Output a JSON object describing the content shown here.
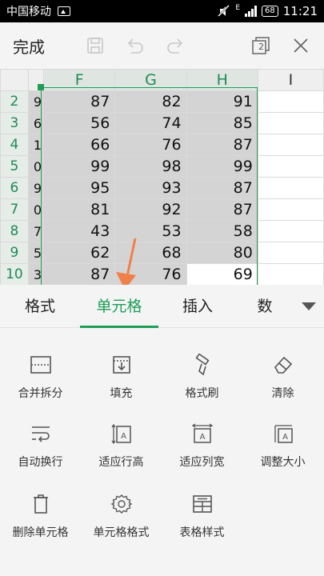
{
  "status": {
    "carrier": "中国移动",
    "battery": "68",
    "time": "11:21",
    "net": "E"
  },
  "toolbar": {
    "done": "完成",
    "window_count": "2"
  },
  "sheet": {
    "columns": [
      "F",
      "G",
      "H",
      "I"
    ],
    "rows": [
      {
        "row": "2",
        "e": "9",
        "f": "87",
        "g": "82",
        "h": "91"
      },
      {
        "row": "3",
        "e": "6",
        "f": "56",
        "g": "74",
        "h": "85"
      },
      {
        "row": "4",
        "e": "1",
        "f": "66",
        "g": "76",
        "h": "87"
      },
      {
        "row": "5",
        "e": "0",
        "f": "99",
        "g": "98",
        "h": "99"
      },
      {
        "row": "6",
        "e": "9",
        "f": "95",
        "g": "93",
        "h": "87"
      },
      {
        "row": "7",
        "e": "0",
        "f": "81",
        "g": "92",
        "h": "87"
      },
      {
        "row": "8",
        "e": "7",
        "f": "43",
        "g": "53",
        "h": "58"
      },
      {
        "row": "9",
        "e": "5",
        "f": "62",
        "g": "68",
        "h": "80"
      },
      {
        "row": "10",
        "e": "3",
        "f": "87",
        "g": "76",
        "h": "69"
      }
    ]
  },
  "tabs": {
    "format": "格式",
    "cell": "单元格",
    "insert": "插入",
    "data": "数"
  },
  "tools": {
    "merge_split": "合并拆分",
    "fill": "填充",
    "format_painter": "格式刷",
    "clear": "清除",
    "auto_wrap": "自动换行",
    "fit_row_height": "适应行高",
    "fit_col_width": "适应列宽",
    "resize": "调整大小",
    "delete_cell": "删除单元格",
    "cell_format": "单元格格式",
    "table_style": "表格样式"
  },
  "colors": {
    "accent": "#1f9d58",
    "annotation_arrow": "#f0804a"
  }
}
